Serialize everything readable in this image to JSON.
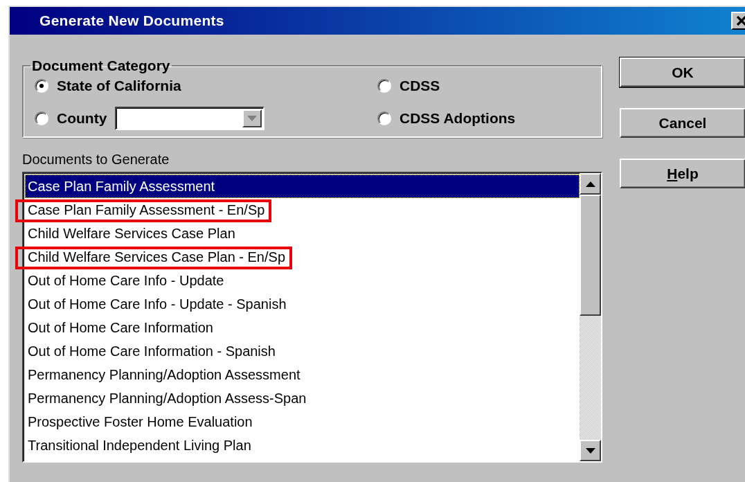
{
  "window": {
    "title": "Generate New Documents"
  },
  "category": {
    "legend": "Document Category",
    "options": [
      {
        "label": "State of California",
        "selected": true,
        "kind": "radio"
      },
      {
        "label": "CDSS",
        "selected": false,
        "kind": "radio"
      },
      {
        "label": "County",
        "selected": false,
        "kind": "radio-dropdown"
      },
      {
        "label": "CDSS Adoptions",
        "selected": false,
        "kind": "radio"
      }
    ]
  },
  "documents": {
    "label": "Documents to Generate",
    "items": [
      {
        "text": "Case Plan Family Assessment",
        "selected": true,
        "highlighted": false
      },
      {
        "text": "Case Plan Family Assessment - En/Sp",
        "selected": false,
        "highlighted": true
      },
      {
        "text": "Child Welfare Services Case Plan",
        "selected": false,
        "highlighted": false
      },
      {
        "text": "Child Welfare Services Case Plan - En/Sp",
        "selected": false,
        "highlighted": true
      },
      {
        "text": "Out of Home Care Info - Update",
        "selected": false,
        "highlighted": false
      },
      {
        "text": "Out of Home Care Info - Update - Spanish",
        "selected": false,
        "highlighted": false
      },
      {
        "text": "Out of Home Care Information",
        "selected": false,
        "highlighted": false
      },
      {
        "text": "Out of Home Care Information - Spanish",
        "selected": false,
        "highlighted": false
      },
      {
        "text": "Permanency Planning/Adoption Assessment",
        "selected": false,
        "highlighted": false
      },
      {
        "text": "Permanency Planning/Adoption Assess-Span",
        "selected": false,
        "highlighted": false
      },
      {
        "text": "Prospective Foster Home Evaluation",
        "selected": false,
        "highlighted": false
      },
      {
        "text": "Transitional Independent Living Plan",
        "selected": false,
        "highlighted": false
      }
    ]
  },
  "buttons": [
    {
      "label": "OK",
      "default": true,
      "underline_first": false
    },
    {
      "label": "Cancel",
      "default": false,
      "underline_first": false
    },
    {
      "label": "Help",
      "default": false,
      "underline_first": true
    }
  ]
}
